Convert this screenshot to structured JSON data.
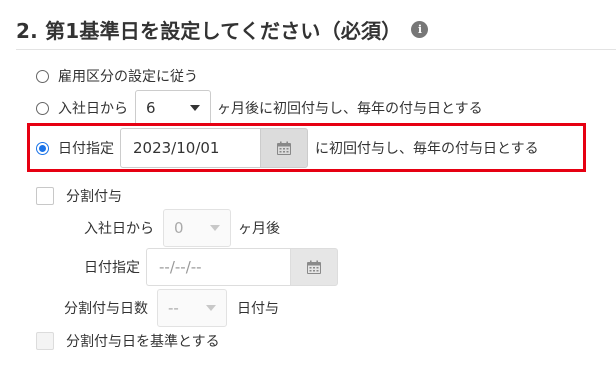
{
  "section": {
    "title": "2. 第1基準日を設定してください（必須）",
    "info_icon": "info-icon"
  },
  "options": {
    "employment_category": {
      "label": "雇用区分の設定に従う",
      "checked": false
    },
    "months_after_hire": {
      "prefix": "入社日から",
      "select_value": "6",
      "suffix": "ヶ月後に初回付与し、毎年の付与日とする",
      "checked": false
    },
    "date_specified": {
      "label": "日付指定",
      "date_value": "2023/10/01",
      "suffix": "に初回付与し、毎年の付与日とする",
      "checked": true
    }
  },
  "split": {
    "checkbox_label": "分割付与",
    "months_prefix": "入社日から",
    "months_select_value": "0",
    "months_suffix": "ヶ月後",
    "date_label": "日付指定",
    "date_placeholder": "--/--/--",
    "days_label": "分割付与日数",
    "days_select_value": "--",
    "days_suffix": "日付与",
    "base_checkbox_label": "分割付与日を基準とする"
  },
  "colors": {
    "highlight_border": "#e60012",
    "radio_accent": "#1a73e8"
  }
}
